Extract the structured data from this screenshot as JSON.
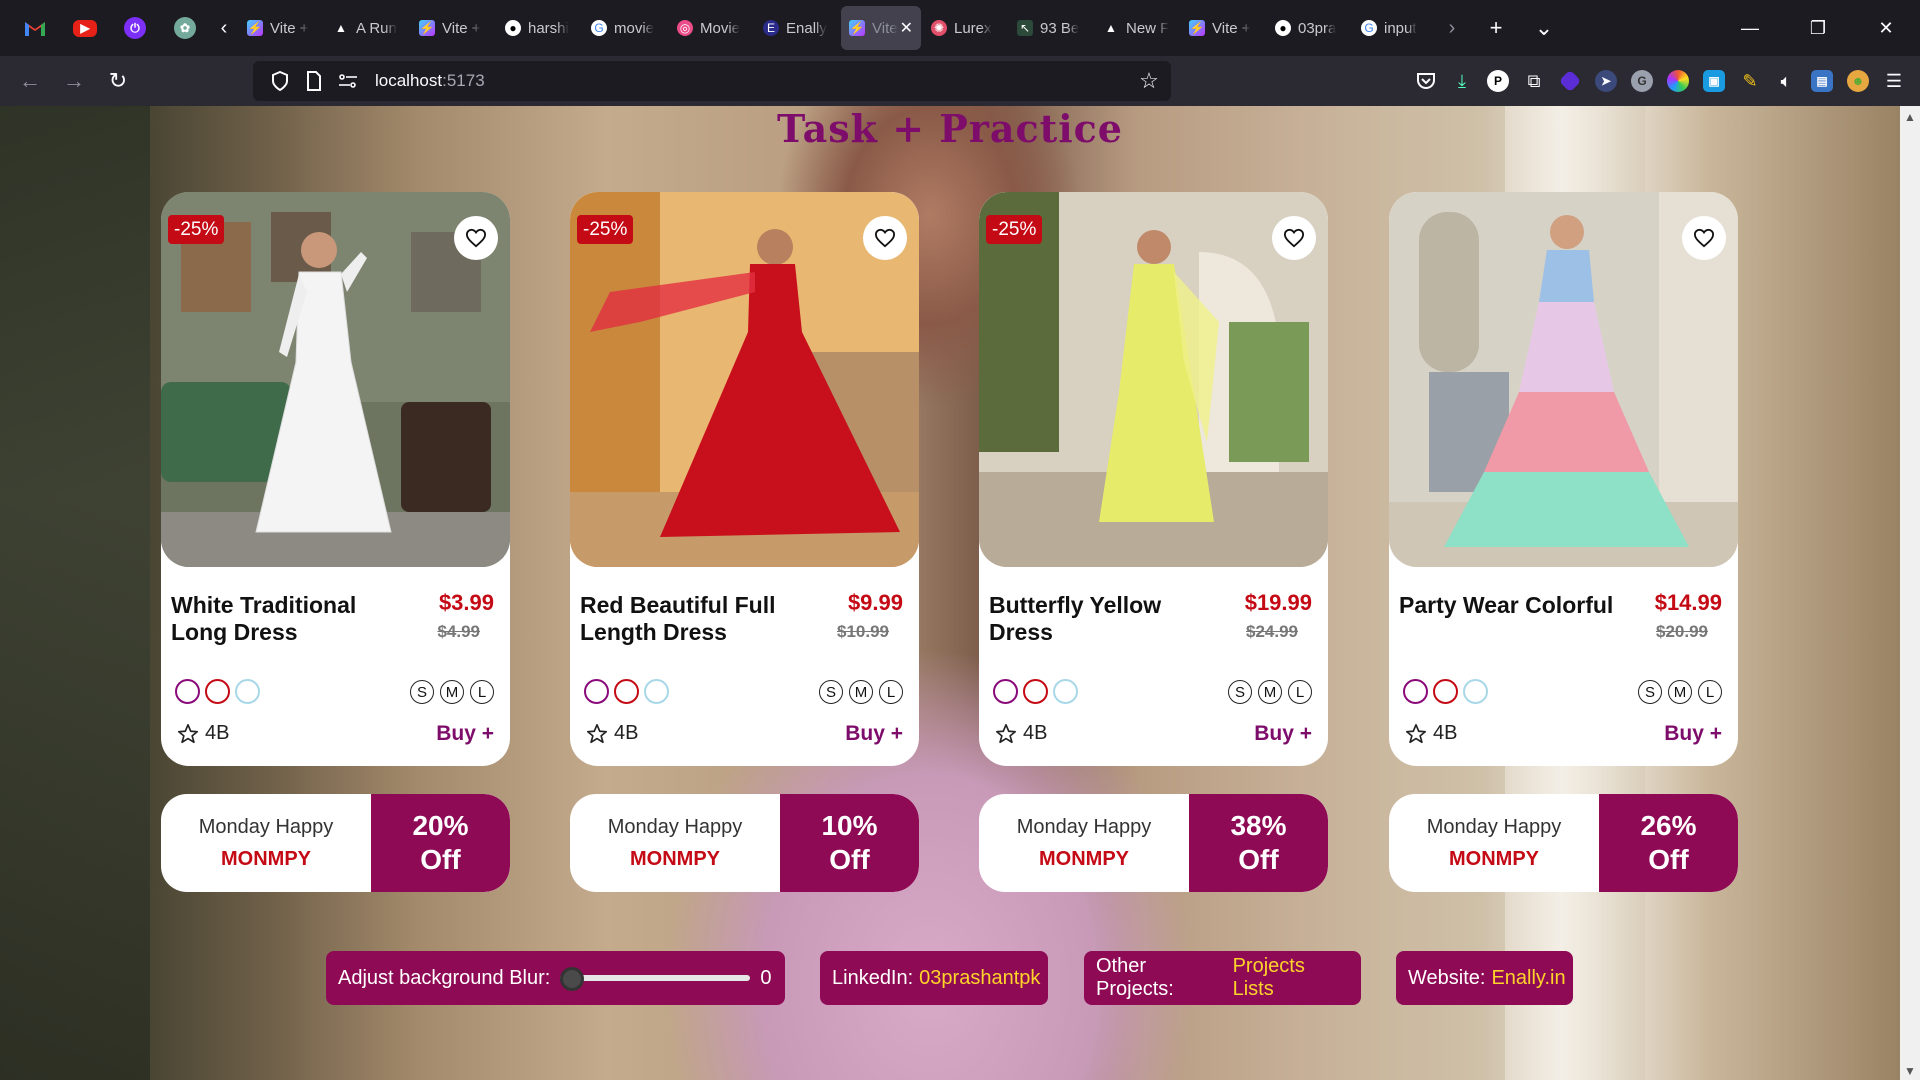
{
  "browser": {
    "tabs": [
      {
        "title": "Vite +",
        "icon": "vite-icon"
      },
      {
        "title": "A Run",
        "icon": "triangle-icon"
      },
      {
        "title": "Vite +",
        "icon": "vite-icon"
      },
      {
        "title": "harshi",
        "icon": "github-icon"
      },
      {
        "title": "movie",
        "icon": "google-icon"
      },
      {
        "title": "Movie",
        "icon": "dribbble-icon"
      },
      {
        "title": "Enally",
        "icon": "enally-icon"
      },
      {
        "title": "Vite",
        "icon": "vite-icon",
        "active": true
      },
      {
        "title": "Lurex",
        "icon": "lurex-icon"
      },
      {
        "title": "93 Be",
        "icon": "cursor-icon"
      },
      {
        "title": "New F",
        "icon": "triangle-icon"
      },
      {
        "title": "Vite +",
        "icon": "vite-icon"
      },
      {
        "title": "03pra",
        "icon": "github-icon"
      },
      {
        "title": "input",
        "icon": "google-icon"
      }
    ],
    "url_host": "localhost",
    "url_port": ":5173"
  },
  "page": {
    "title": "Task + Practice",
    "products": [
      {
        "badge": "-25%",
        "name": "White Traditional Long Dress",
        "price": "$3.99",
        "old_price": "$4.99",
        "sizes": [
          "S",
          "M",
          "L"
        ],
        "rating": "4B",
        "buy": "Buy +"
      },
      {
        "badge": "-25%",
        "name": "Red Beautiful Full Length Dress",
        "price": "$9.99",
        "old_price": "$10.99",
        "sizes": [
          "S",
          "M",
          "L"
        ],
        "rating": "4B",
        "buy": "Buy +"
      },
      {
        "badge": "-25%",
        "name": "Butterfly Yellow Dress",
        "price": "$19.99",
        "old_price": "$24.99",
        "sizes": [
          "S",
          "M",
          "L"
        ],
        "rating": "4B",
        "buy": "Buy +"
      },
      {
        "name": "Party Wear Colorful",
        "price": "$14.99",
        "old_price": "$20.99",
        "sizes": [
          "S",
          "M",
          "L"
        ],
        "rating": "4B",
        "buy": "Buy +"
      }
    ],
    "coupons": [
      {
        "day": "Monday Happy",
        "code": "MONMPY",
        "pct": "20%",
        "off": "Off"
      },
      {
        "day": "Monday Happy",
        "code": "MONMPY",
        "pct": "10%",
        "off": "Off"
      },
      {
        "day": "Monday Happy",
        "code": "MONMPY",
        "pct": "38%",
        "off": "Off"
      },
      {
        "day": "Monday Happy",
        "code": "MONMPY",
        "pct": "26%",
        "off": "Off"
      }
    ],
    "footer": {
      "blur_label": "Adjust background Blur:",
      "blur_value": "0",
      "linkedin_label": "LinkedIn:",
      "linkedin_value": "03prashantpk",
      "projects_label": "Other Projects:",
      "projects_value": "Projects Lists",
      "website_label": "Website:",
      "website_value": "Enally.in"
    }
  },
  "colors": {
    "accent": "#8f0a55",
    "title": "#7d0c6b",
    "price": "#c40a14",
    "link": "#ffd42a",
    "swatches": [
      "#8a0a7a",
      "#c40a14",
      "#a8d8e8"
    ]
  }
}
